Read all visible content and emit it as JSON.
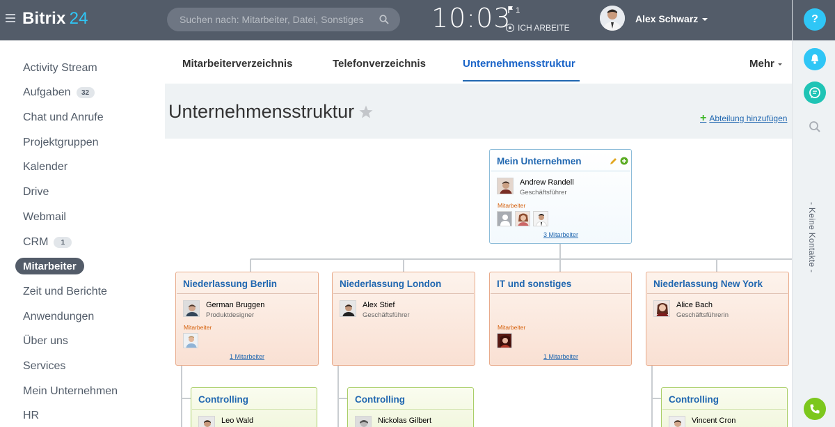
{
  "app": {
    "logo_main": "Bitrix",
    "logo_num": "24"
  },
  "topbar": {
    "search_placeholder": "Suchen nach: Mitarbeiter, Datei, Sonstiges",
    "time": "10:03",
    "flag_count": "1",
    "work_status": "ICH ARBEITE",
    "user_name": "Alex Schwarz"
  },
  "rightpanel": {
    "help_label": "?",
    "contacts_label": "- Keine Kontakte -"
  },
  "sidebar": {
    "items": [
      {
        "label": "Activity Stream"
      },
      {
        "label": "Aufgaben",
        "badge": "32"
      },
      {
        "label": "Chat und Anrufe"
      },
      {
        "label": "Projektgruppen"
      },
      {
        "label": "Kalender"
      },
      {
        "label": "Drive"
      },
      {
        "label": "Webmail"
      },
      {
        "label": "CRM",
        "badge": "1"
      },
      {
        "label": "Mitarbeiter",
        "active": true
      },
      {
        "label": "Zeit und Berichte"
      },
      {
        "label": "Anwendungen"
      },
      {
        "label": "Über uns"
      },
      {
        "label": "Services"
      },
      {
        "label": "Mein Unternehmen"
      },
      {
        "label": "HR"
      }
    ]
  },
  "tabs": {
    "items": [
      "Mitarbeiterverzeichnis",
      "Telefonverzeichnis",
      "Unternehmensstruktur"
    ],
    "active": "Unternehmensstruktur",
    "more": "Mehr"
  },
  "page": {
    "title": "Unternehmensstruktur",
    "add_department": "Abteilung hinzufügen"
  },
  "org": {
    "root": {
      "title": "Mein Unternehmen",
      "head_name": "Andrew Randell",
      "head_role": "Geschäftsführer",
      "employees_label": "Mitarbeiter",
      "employees_link": "3 Mitarbeiter"
    },
    "branches": [
      {
        "title": "Niederlassung Berlin",
        "head_name": "German Bruggen",
        "head_role": "Produktdesigner",
        "employees_label": "Mitarbeiter",
        "employees_link": "1 Mitarbeiter"
      },
      {
        "title": "Niederlassung London",
        "head_name": "Alex Stief",
        "head_role": "Geschäftsführer"
      },
      {
        "title": "IT und sonstiges",
        "employees_label": "Mitarbeiter",
        "employees_link": "1 Mitarbeiter"
      },
      {
        "title": "Niederlassung New York",
        "head_name": "Alice Bach",
        "head_role": "Geschäftsführerin"
      }
    ],
    "subdepartments": [
      {
        "title": "Controlling",
        "head_name": "Leo Wald"
      },
      {
        "title": "Controlling",
        "head_name": "Nickolas Gilbert"
      },
      {
        "title": "Controlling",
        "head_name": "Vincent Cron"
      }
    ]
  },
  "colors": {
    "topbar": "#535c69",
    "accent": "#2fc6f6",
    "link": "#2067b0",
    "branch_border": "#e8aa8a",
    "sub_border": "#a9ce67",
    "root_border": "#8cbcd9"
  }
}
